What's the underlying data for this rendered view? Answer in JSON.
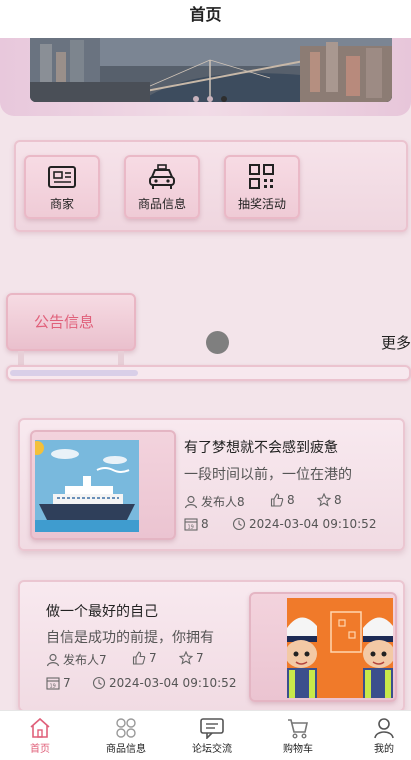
{
  "header": {
    "title": "首页"
  },
  "banner": {
    "slide_count": 3,
    "active_slide": 3
  },
  "menu": {
    "items": [
      {
        "label": "商家",
        "icon": "id-card-icon"
      },
      {
        "label": "商品信息",
        "icon": "taxi-icon"
      },
      {
        "label": "抽奖活动",
        "icon": "qr-grid-icon"
      }
    ]
  },
  "notice": {
    "tab_label": "公告信息",
    "more_label": "更多",
    "scroll_progress": 0.32
  },
  "news": [
    {
      "title": "有了梦想就不会感到疲惫",
      "desc": "一段时间以前，一位在港的",
      "author": "发布人8",
      "likes": "8",
      "favorites": "8",
      "views": "8",
      "time": "2024-03-04 09:10:52",
      "image": "cruise-ship-illustration"
    },
    {
      "title": "做一个最好的自己",
      "desc": "自信是成功的前提，你拥有",
      "author": "发布人7",
      "likes": "7",
      "favorites": "7",
      "views": "7",
      "time": "2024-03-04 09:10:52",
      "image": "traffic-police-illustration"
    }
  ],
  "tabbar": {
    "items": [
      {
        "label": "首页",
        "icon": "home-icon",
        "active": true
      },
      {
        "label": "商品信息",
        "icon": "flower-grid-icon",
        "active": false
      },
      {
        "label": "论坛交流",
        "icon": "chat-icon",
        "active": false
      },
      {
        "label": "购物车",
        "icon": "cart-icon",
        "active": false
      },
      {
        "label": "我的",
        "icon": "person-icon",
        "active": false
      }
    ],
    "active_color": "#e0607a"
  },
  "colors": {
    "accent": "#e0607a",
    "card_border": "#ebc6d1",
    "background": "#f3e4ea"
  }
}
